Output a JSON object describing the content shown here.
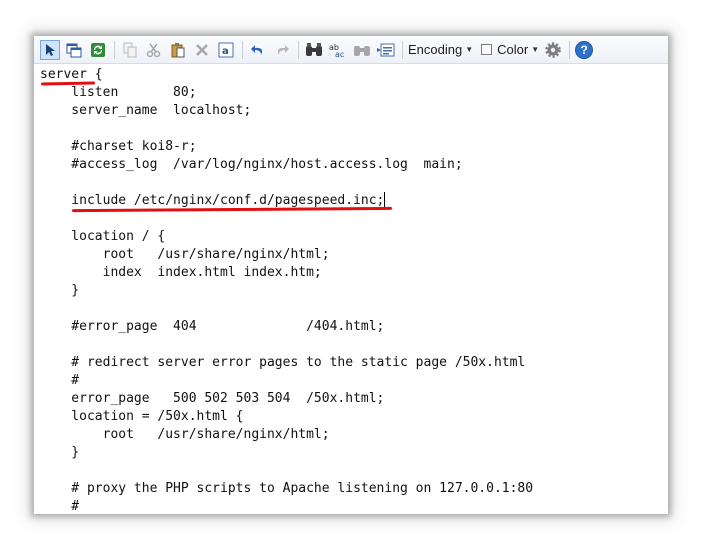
{
  "toolbar": {
    "encoding_label": "Encoding",
    "color_label": "Color",
    "help_label": "?",
    "icons": [
      "select-icon",
      "new-window-icon",
      "refresh-icon",
      "copy-icon",
      "cut-icon",
      "paste-icon",
      "delete-icon",
      "select-all-icon",
      "undo-icon",
      "redo-icon",
      "find-icon",
      "replace-icon",
      "find-next-icon",
      "goto-icon"
    ]
  },
  "editor": {
    "lines": [
      "server {",
      "    listen       80;",
      "    server_name  localhost;",
      "",
      "    #charset koi8-r;",
      "    #access_log  /var/log/nginx/host.access.log  main;",
      "",
      "    include /etc/nginx/conf.d/pagespeed.inc;",
      "",
      "    location / {",
      "        root   /usr/share/nginx/html;",
      "        index  index.html index.htm;",
      "    }",
      "",
      "    #error_page  404              /404.html;",
      "",
      "    # redirect server error pages to the static page /50x.html",
      "    #",
      "    error_page   500 502 503 504  /50x.html;",
      "    location = /50x.html {",
      "        root   /usr/share/nginx/html;",
      "    }",
      "",
      "    # proxy the PHP scripts to Apache listening on 127.0.0.1:80",
      "    #"
    ]
  },
  "colors": {
    "highlight": "#e01010",
    "accent": "#2d71c9"
  }
}
